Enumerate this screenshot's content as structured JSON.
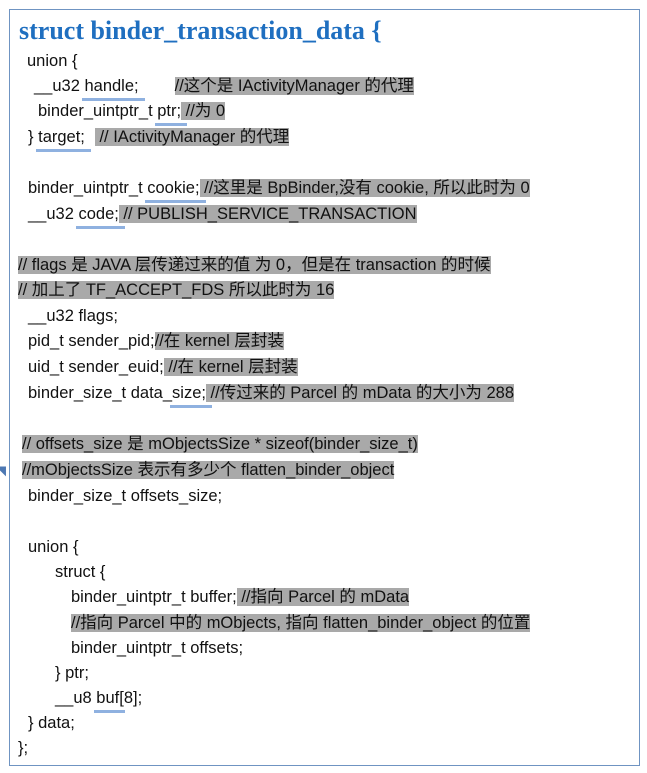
{
  "title": "struct binder_transaction_data {",
  "lines": {
    "union_open": "union {",
    "handle_type": "__u32 ",
    "handle_name": "handle;",
    "handle_comment": "//这个是 IActivityManager 的代理",
    "ptr_type": "binder_uintptr_t ",
    "ptr_name": "ptr;",
    "ptr_comment": " //为 0",
    "target_close": "} ",
    "target_name": "target;",
    "target_comment": " // IActivityManager 的代理",
    "cookie_type": "binder_uintptr_t ",
    "cookie_name": "cookie;",
    "cookie_comment": " //这里是 BpBinder,没有 cookie, 所以此时为 0",
    "code_type": "__u32 ",
    "code_name": "code;",
    "code_comment": " // PUBLISH_SERVICE_TRANSACTION",
    "flags_comment1": "// flags 是 JAVA 层传递过来的值 为 0，但是在 transaction 的时候",
    "flags_comment2": "// 加上了 TF_ACCEPT_FDS 所以此时为 16",
    "flags_decl": "__u32 flags;",
    "pid_decl": "pid_t sender_pid;",
    "pid_comment": "//在 kernel 层封装",
    "euid_decl": "uid_t sender_euid;",
    "euid_comment": " //在 kernel 层封装",
    "datasize_type": "binder_size_t data_",
    "datasize_name": "size;",
    "datasize_comment": " //传过来的 Parcel 的 mData 的大小为 288",
    "offsets_comment1": " // offsets_size 是 mObjectsSize * sizeof(binder_size_t)",
    "offsets_comment2": " //mObjectsSize 表示有多少个 flatten_binder_object",
    "offsets_decl": "binder_size_t offsets_size;",
    "union2_open": "union {",
    "struct_open": "struct {",
    "buffer_decl": "binder_uintptr_t buffer;",
    "buffer_comment": " //指向 Parcel 的 mData",
    "objects_comment": "//指向 Parcel 中的 mObjects, 指向 flatten_binder_object 的位置",
    "offsets_ptr_decl": "binder_uintptr_t offsets;",
    "ptr_close": "} ptr;",
    "buf_type": "__u8 ",
    "buf_name": "buf",
    "buf_suffix": "[8];",
    "data_close": "} data;",
    "struct_close": "};"
  }
}
